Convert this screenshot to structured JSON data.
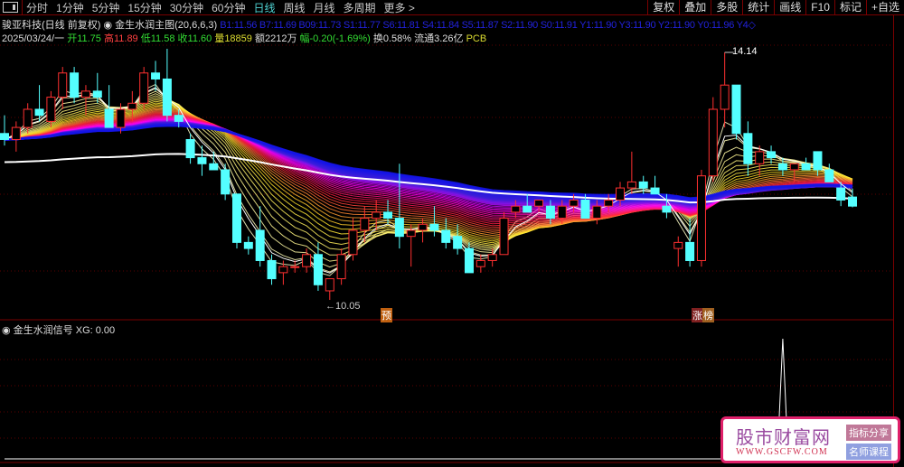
{
  "toolbar": {
    "periods": [
      "分时",
      "1分钟",
      "5分钟",
      "15分钟",
      "30分钟",
      "60分钟",
      "日线",
      "周线",
      "月线",
      "多周期",
      "更多 >"
    ],
    "active": "日线",
    "right_buttons": [
      "复权",
      "叠加",
      "多股",
      "统计",
      "画线",
      "F10",
      "标记",
      "+自选"
    ]
  },
  "header": {
    "stock": "骏亚科技(日线 前复权)",
    "indicator": "金生水润主图(20,6,6,3)",
    "lines": "B1:11.56 B7:11.69 B09:11.73 S1:11.77 S6:11.81 S4:11.84 S5:11.87 S2:11.90 S0:11.91 Y1:11.90 Y3:11.90 Y2:11.90 Y0:11.96 Y4◇",
    "date": "2025/03/24/一",
    "open_label": "开",
    "open": "11.75",
    "high_label": "高",
    "high": "11.89",
    "low_label": "低",
    "low": "11.58",
    "close_label": "收",
    "close": "11.60",
    "vol_label": "量",
    "vol": "18859",
    "amount": "额2212万",
    "change": "幅-0.20(-1.69%)",
    "turnover": "换0.58%",
    "float": "流通3.26亿",
    "sector": "PCB"
  },
  "chart": {
    "high_label": "14.14",
    "low_label": "←10.05",
    "mark_yu": "预",
    "mark_zhang": "涨",
    "mark_bang": "榜",
    "candles": [
      [
        12.8,
        13.1,
        12.6,
        12.7
      ],
      [
        12.7,
        13.0,
        12.5,
        12.9
      ],
      [
        12.9,
        13.3,
        12.8,
        13.2
      ],
      [
        13.2,
        13.6,
        13.0,
        13.1
      ],
      [
        13.0,
        13.5,
        12.9,
        13.4
      ],
      [
        13.4,
        13.9,
        13.2,
        13.8
      ],
      [
        13.8,
        13.9,
        13.3,
        13.4
      ],
      [
        13.4,
        13.6,
        13.1,
        13.5
      ],
      [
        13.5,
        13.8,
        13.3,
        13.4
      ],
      [
        13.2,
        13.6,
        12.9,
        12.9
      ],
      [
        12.9,
        13.3,
        12.8,
        13.2
      ],
      [
        13.2,
        13.5,
        13.0,
        13.3
      ],
      [
        13.3,
        13.9,
        13.2,
        13.8
      ],
      [
        13.8,
        14.0,
        13.5,
        13.7
      ],
      [
        13.7,
        14.2,
        13.0,
        13.1
      ],
      [
        13.1,
        13.2,
        12.9,
        13.0
      ],
      [
        12.7,
        12.8,
        12.3,
        12.4
      ],
      [
        12.4,
        12.6,
        12.1,
        12.3
      ],
      [
        12.3,
        12.5,
        12.2,
        12.2
      ],
      [
        12.2,
        12.3,
        11.7,
        11.8
      ],
      [
        11.8,
        11.8,
        10.9,
        11.0
      ],
      [
        11.0,
        11.1,
        10.8,
        10.9
      ],
      [
        11.2,
        11.6,
        10.6,
        10.7
      ],
      [
        10.7,
        10.8,
        10.3,
        10.4
      ],
      [
        10.5,
        10.7,
        10.3,
        10.6
      ],
      [
        10.6,
        10.7,
        10.5,
        10.6
      ],
      [
        10.6,
        10.9,
        10.5,
        10.8
      ],
      [
        10.8,
        11.0,
        10.2,
        10.3
      ],
      [
        10.2,
        10.4,
        10.05,
        10.4
      ],
      [
        10.4,
        10.9,
        10.3,
        10.8
      ],
      [
        10.8,
        11.4,
        10.7,
        11.2
      ],
      [
        11.2,
        11.6,
        11.0,
        11.4
      ],
      [
        11.4,
        11.7,
        11.2,
        11.5
      ],
      [
        11.5,
        11.7,
        11.3,
        11.4
      ],
      [
        11.4,
        12.3,
        10.9,
        11.1
      ],
      [
        11.1,
        11.3,
        10.6,
        11.2
      ],
      [
        11.2,
        11.4,
        11.0,
        11.3
      ],
      [
        11.3,
        11.6,
        11.1,
        11.2
      ],
      [
        11.2,
        11.4,
        10.9,
        11.0
      ],
      [
        11.1,
        11.3,
        10.8,
        10.9
      ],
      [
        10.9,
        11.0,
        10.5,
        10.5
      ],
      [
        10.6,
        10.8,
        10.5,
        10.7
      ],
      [
        10.7,
        10.9,
        10.6,
        10.8
      ],
      [
        10.8,
        11.5,
        10.8,
        11.4
      ],
      [
        11.5,
        11.7,
        11.4,
        11.6
      ],
      [
        11.6,
        11.8,
        11.5,
        11.5
      ],
      [
        11.6,
        11.7,
        11.5,
        11.7
      ],
      [
        11.6,
        11.7,
        11.3,
        11.4
      ],
      [
        11.4,
        11.7,
        11.3,
        11.6
      ],
      [
        11.6,
        11.8,
        11.5,
        11.7
      ],
      [
        11.7,
        11.8,
        11.4,
        11.4
      ],
      [
        11.4,
        11.7,
        11.3,
        11.6
      ],
      [
        11.6,
        11.8,
        11.5,
        11.7
      ],
      [
        11.7,
        12.0,
        11.6,
        11.9
      ],
      [
        11.9,
        12.5,
        11.8,
        12.0
      ],
      [
        12.0,
        12.1,
        11.8,
        11.9
      ],
      [
        11.9,
        12.1,
        11.8,
        11.8
      ],
      [
        11.6,
        11.8,
        11.4,
        11.5
      ],
      [
        10.9,
        11.1,
        10.6,
        11.0
      ],
      [
        11.0,
        11.4,
        10.6,
        10.7
      ],
      [
        10.7,
        12.2,
        10.6,
        12.1
      ],
      [
        12.1,
        13.4,
        12.0,
        13.2
      ],
      [
        13.2,
        14.14,
        12.9,
        13.6
      ],
      [
        13.6,
        13.6,
        12.7,
        12.8
      ],
      [
        12.8,
        13.0,
        12.1,
        12.3
      ],
      [
        12.3,
        12.6,
        12.1,
        12.5
      ],
      [
        12.5,
        12.6,
        12.3,
        12.4
      ],
      [
        12.3,
        12.4,
        12.1,
        12.2
      ],
      [
        12.2,
        12.3,
        12.0,
        12.3
      ],
      [
        12.3,
        12.4,
        12.2,
        12.2
      ],
      [
        12.5,
        12.5,
        12.1,
        12.2
      ],
      [
        12.2,
        12.3,
        12.0,
        12.0
      ],
      [
        11.9,
        12.0,
        11.6,
        11.7
      ],
      [
        11.75,
        11.89,
        11.58,
        11.6
      ]
    ]
  },
  "indicator": {
    "title": "金生水润信号",
    "xg_label": "XG: 0.00",
    "spike_index": 67
  },
  "logo": {
    "name": "股市财富网",
    "url": "WWW.GSCFW.COM",
    "tag1": "指标分享",
    "tag2": "名师课程"
  },
  "colors": {
    "up": "#ff3030",
    "down": "#54ffff",
    "grid": "#7a0000"
  }
}
